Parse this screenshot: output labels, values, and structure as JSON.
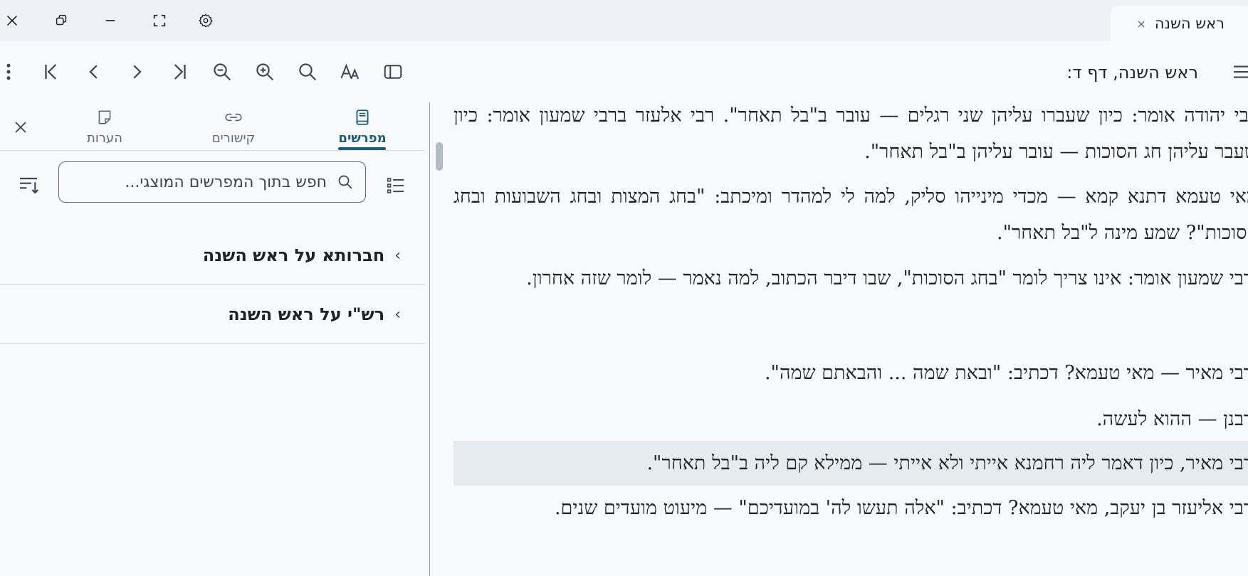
{
  "window": {
    "tab_title": "ראש השנה",
    "tab_close": "×"
  },
  "toolbar": {
    "breadcrumb": "ראש השנה, דף ד:",
    "icons": [
      "more-vert-icon",
      "first-page-icon",
      "previous-icon",
      "next-icon",
      "last-page-icon",
      "zoom-out-icon",
      "zoom-in-icon",
      "search-icon",
      "font-settings-icon",
      "toggle-sidebar-icon",
      "menu-icon"
    ]
  },
  "panel": {
    "tabs": [
      {
        "label": "מפרשים",
        "icon": "book-icon",
        "active": true
      },
      {
        "label": "קישורים",
        "icon": "link-icon",
        "active": false
      },
      {
        "label": "הערות",
        "icon": "note-icon",
        "active": false
      }
    ],
    "filter_placeholder": "חפש בתוך המפרשים המוצגי...",
    "commentaries": [
      {
        "label": "חברותא על ראש השנה"
      },
      {
        "label": "רש\"י על ראש השנה"
      }
    ]
  },
  "main": {
    "paragraphs": [
      {
        "text": "רבי יהודה אומר: כיון שעברו עליהן שני רגלים — עובר ב\"בל תאחר\". רבי אלעזר ברבי שמעון אומר: כיון שעבר עליהן חג הסוכות — עובר עליהן ב\"בל תאחר\".",
        "highlighted": false
      },
      {
        "text": "מאי טעמא דתנא קמא — מכדי מינייהו סליק, למה לי למהדר ומיכתב: \"בחג המצות ובחג השבועות ובחג הסוכות\"? שמע מינה ל\"בל תאחר\".",
        "highlighted": false
      },
      {
        "text": "ורבי שמעון אומר: אינו צריך לומר \"בחג הסוכות\", שבו דיבר הכתוב, למה נאמר — לומר שזה אחרון.",
        "highlighted": false
      },
      {
        "text": "ורבי מאיר — מאי טעמא? דכתיב: \"ובאת שמה ... והבאתם שמה\".",
        "highlighted": false
      },
      {
        "text": "ורבנן — ההוא לעשה.",
        "highlighted": false
      },
      {
        "text": "ורבי מאיר, כיון דאמר ליה רחמנא אייתי ולא אייתי — ממילא קם ליה ב\"בל תאחר\".",
        "highlighted": true
      },
      {
        "text": "ורבי אליעזר בן יעקב, מאי טעמא? דכתיב: \"אלה תעשו לה' במועדיכם\" — מיעוט מועדים שנים.",
        "highlighted": false
      }
    ]
  }
}
